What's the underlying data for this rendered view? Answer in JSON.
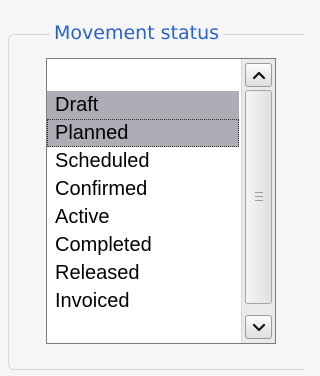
{
  "group": {
    "legend": "Movement status"
  },
  "listbox": {
    "items": [
      {
        "label": "Draft",
        "selected": true
      },
      {
        "label": "Planned",
        "selected": true,
        "focused": true
      },
      {
        "label": "Scheduled",
        "selected": false
      },
      {
        "label": "Confirmed",
        "selected": false
      },
      {
        "label": "Active",
        "selected": false
      },
      {
        "label": "Completed",
        "selected": false
      },
      {
        "label": "Released",
        "selected": false
      },
      {
        "label": "Invoiced",
        "selected": false
      }
    ],
    "scrollbar": {
      "up_icon": "chevron-up-icon",
      "down_icon": "chevron-down-icon",
      "grip_icon": "grip-lines-icon"
    }
  },
  "colors": {
    "legend_text": "#2b62c9",
    "selection_bg": "#adadb5"
  }
}
